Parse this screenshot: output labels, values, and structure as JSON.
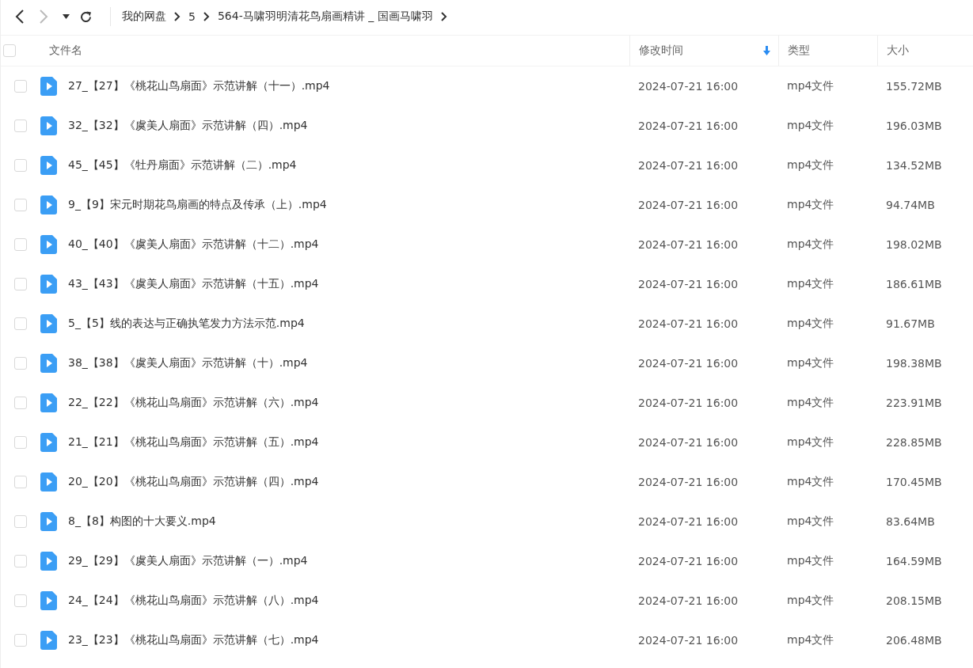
{
  "breadcrumb": [
    "我的网盘",
    "5",
    "564-马啸羽明清花鸟扇画精讲 _ 国画马啸羽"
  ],
  "table": {
    "select_all_checked": false,
    "columns": [
      {
        "label": "文件名",
        "sorted": false
      },
      {
        "label": "修改时间",
        "sorted": true
      },
      {
        "label": "类型",
        "sorted": false
      },
      {
        "label": "大小",
        "sorted": false
      }
    ],
    "rows": [
      {
        "checked": false,
        "name": "27_【27】《桃花山鸟扇面》示范讲解（十一）.mp4",
        "modified": "2024-07-21 16:00",
        "type": "mp4文件",
        "size": "155.72MB"
      },
      {
        "checked": false,
        "name": "32_【32】《虞美人扇面》示范讲解（四）.mp4",
        "modified": "2024-07-21 16:00",
        "type": "mp4文件",
        "size": "196.03MB"
      },
      {
        "checked": false,
        "name": "45_【45】《牡丹扇面》示范讲解（二）.mp4",
        "modified": "2024-07-21 16:00",
        "type": "mp4文件",
        "size": "134.52MB"
      },
      {
        "checked": false,
        "name": "9_【9】宋元时期花鸟扇画的特点及传承（上）.mp4",
        "modified": "2024-07-21 16:00",
        "type": "mp4文件",
        "size": "94.74MB"
      },
      {
        "checked": false,
        "name": "40_【40】《虞美人扇面》示范讲解（十二）.mp4",
        "modified": "2024-07-21 16:00",
        "type": "mp4文件",
        "size": "198.02MB"
      },
      {
        "checked": false,
        "name": "43_【43】《虞美人扇面》示范讲解（十五）.mp4",
        "modified": "2024-07-21 16:00",
        "type": "mp4文件",
        "size": "186.61MB"
      },
      {
        "checked": false,
        "name": "5_【5】线的表达与正确执笔发力方法示范.mp4",
        "modified": "2024-07-21 16:00",
        "type": "mp4文件",
        "size": "91.67MB"
      },
      {
        "checked": false,
        "name": "38_【38】《虞美人扇面》示范讲解（十）.mp4",
        "modified": "2024-07-21 16:00",
        "type": "mp4文件",
        "size": "198.38MB"
      },
      {
        "checked": false,
        "name": "22_【22】《桃花山鸟扇面》示范讲解（六）.mp4",
        "modified": "2024-07-21 16:00",
        "type": "mp4文件",
        "size": "223.91MB"
      },
      {
        "checked": false,
        "name": "21_【21】《桃花山鸟扇面》示范讲解（五）.mp4",
        "modified": "2024-07-21 16:00",
        "type": "mp4文件",
        "size": "228.85MB"
      },
      {
        "checked": false,
        "name": "20_【20】《桃花山鸟扇面》示范讲解（四）.mp4",
        "modified": "2024-07-21 16:00",
        "type": "mp4文件",
        "size": "170.45MB"
      },
      {
        "checked": false,
        "name": "8_【8】构图的十大要义.mp4",
        "modified": "2024-07-21 16:00",
        "type": "mp4文件",
        "size": "83.64MB"
      },
      {
        "checked": false,
        "name": "29_【29】《虞美人扇面》示范讲解（一）.mp4",
        "modified": "2024-07-21 16:00",
        "type": "mp4文件",
        "size": "164.59MB"
      },
      {
        "checked": false,
        "name": "24_【24】《桃花山鸟扇面》示范讲解（八）.mp4",
        "modified": "2024-07-21 16:00",
        "type": "mp4文件",
        "size": "208.15MB"
      },
      {
        "checked": false,
        "name": "23_【23】《桃花山鸟扇面》示范讲解（七）.mp4",
        "modified": "2024-07-21 16:00",
        "type": "mp4文件",
        "size": "206.48MB"
      }
    ]
  }
}
